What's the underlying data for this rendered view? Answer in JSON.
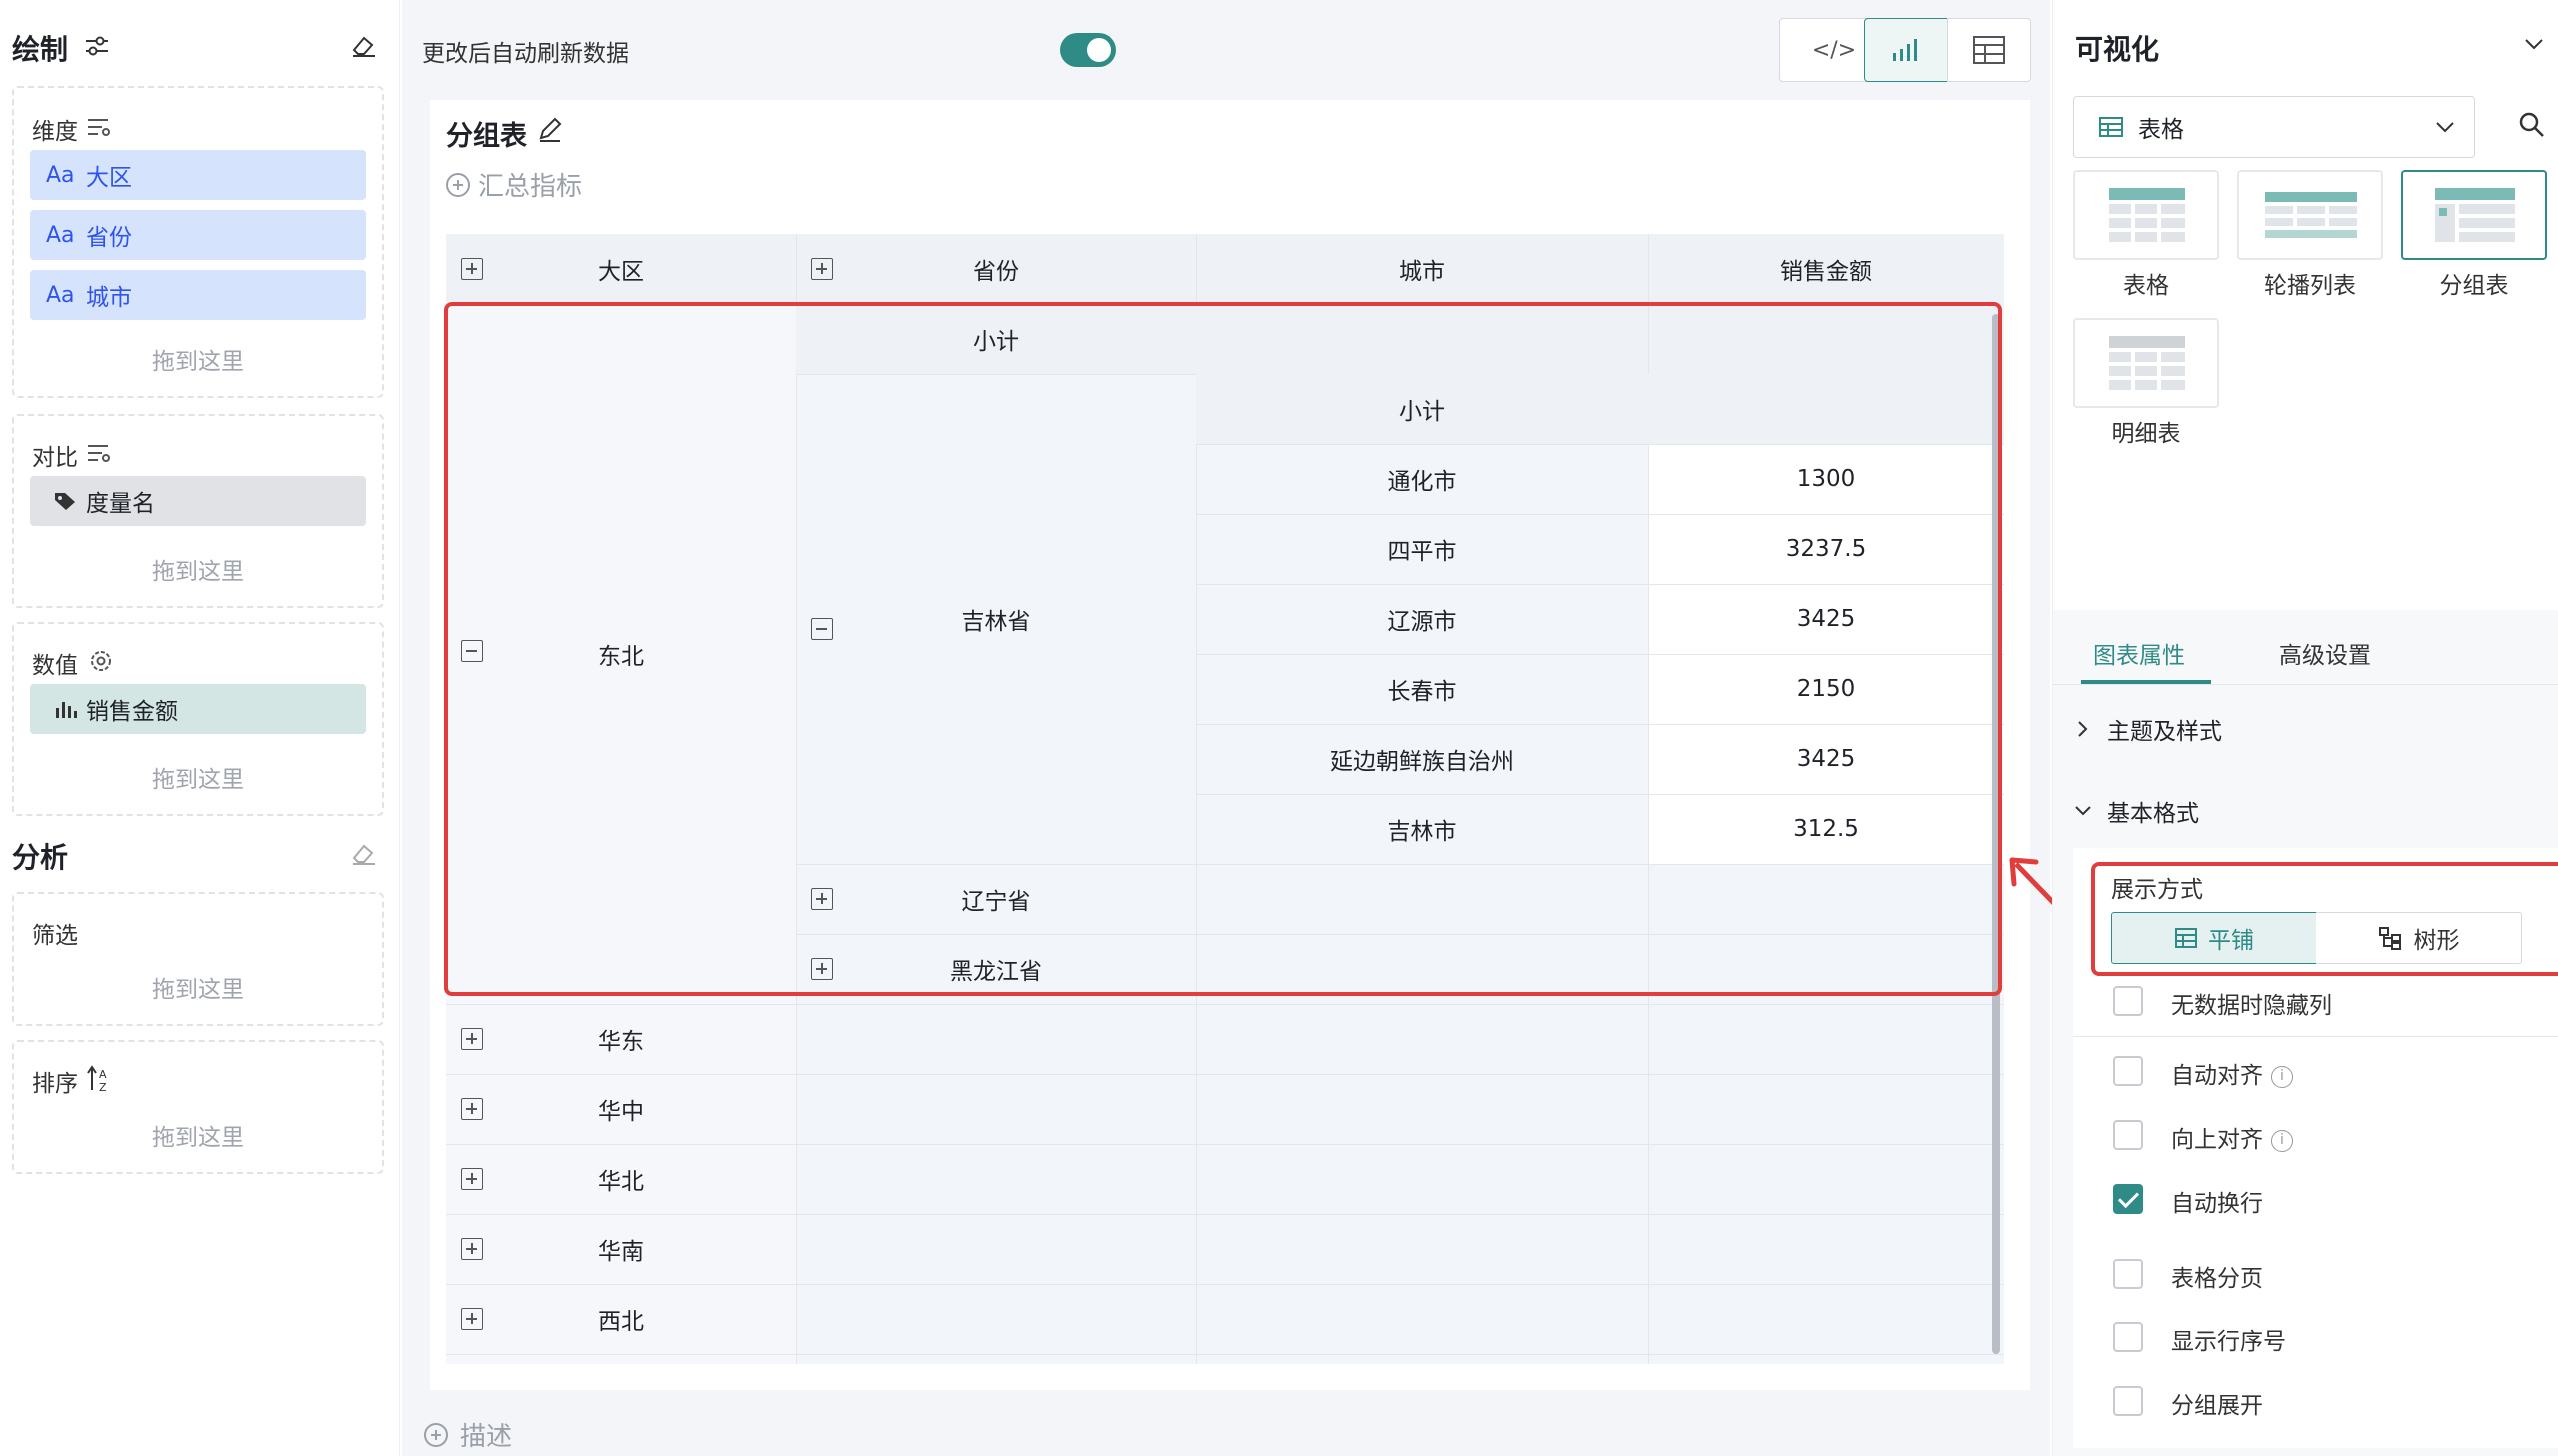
{
  "left": {
    "draw_title": "绘制",
    "dimension": {
      "label": "维度",
      "chips": [
        {
          "icon": "Aa",
          "label": "大区"
        },
        {
          "icon": "Aa",
          "label": "省份"
        },
        {
          "icon": "Aa",
          "label": "城市"
        }
      ],
      "drop_hint": "拖到这里"
    },
    "compare": {
      "label": "对比",
      "chip": "度量名",
      "drop_hint": "拖到这里"
    },
    "value": {
      "label": "数值",
      "chip": "销售金额",
      "drop_hint": "拖到这里"
    },
    "analysis_title": "分析",
    "filter": {
      "label": "筛选",
      "drop_hint": "拖到这里"
    },
    "sort": {
      "label": "排序",
      "drop_hint": "拖到这里"
    }
  },
  "center": {
    "auto_refresh_label": "更改后自动刷新数据",
    "auto_refresh_on": true,
    "code_btn": "</>",
    "chart_title": "分组表",
    "add_metric": "汇总指标",
    "describe": "描述",
    "table": {
      "headers": [
        "大区",
        "省份",
        "城市",
        "销售金额"
      ],
      "region_expanded": "东北",
      "subtotal": "小计",
      "province_expanded": "吉林省",
      "cities": [
        {
          "city": "通化市",
          "amount": "1300"
        },
        {
          "city": "四平市",
          "amount": "3237.5"
        },
        {
          "city": "辽源市",
          "amount": "3425"
        },
        {
          "city": "长春市",
          "amount": "2150"
        },
        {
          "city": "延边朝鲜族自治州",
          "amount": "3425"
        },
        {
          "city": "吉林市",
          "amount": "312.5"
        }
      ],
      "other_provinces": [
        "辽宁省",
        "黑龙江省"
      ],
      "other_regions": [
        "华东",
        "华中",
        "华北",
        "华南",
        "西北"
      ]
    }
  },
  "right": {
    "title": "可视化",
    "chart_select": "表格",
    "types": [
      "表格",
      "轮播列表",
      "分组表",
      "明细表"
    ],
    "selected_type": "分组表",
    "tabs": [
      "图表属性",
      "高级设置"
    ],
    "active_tab": "图表属性",
    "theme_section": "主题及样式",
    "basic_section": "基本格式",
    "display_mode_label": "展示方式",
    "display_modes": [
      "平铺",
      "树形"
    ],
    "active_mode": "平铺",
    "options": [
      {
        "label": "无数据时隐藏列",
        "checked": false,
        "info": false
      },
      {
        "label": "自动对齐",
        "checked": false,
        "info": true
      },
      {
        "label": "向上对齐",
        "checked": false,
        "info": true
      },
      {
        "label": "自动换行",
        "checked": true,
        "info": false
      },
      {
        "label": "表格分页",
        "checked": false,
        "info": false
      },
      {
        "label": "显示行序号",
        "checked": false,
        "info": false
      },
      {
        "label": "分组展开",
        "checked": false,
        "info": false
      }
    ],
    "colors": {
      "accent": "#2e8b86",
      "highlight": "#e23d3d"
    }
  }
}
